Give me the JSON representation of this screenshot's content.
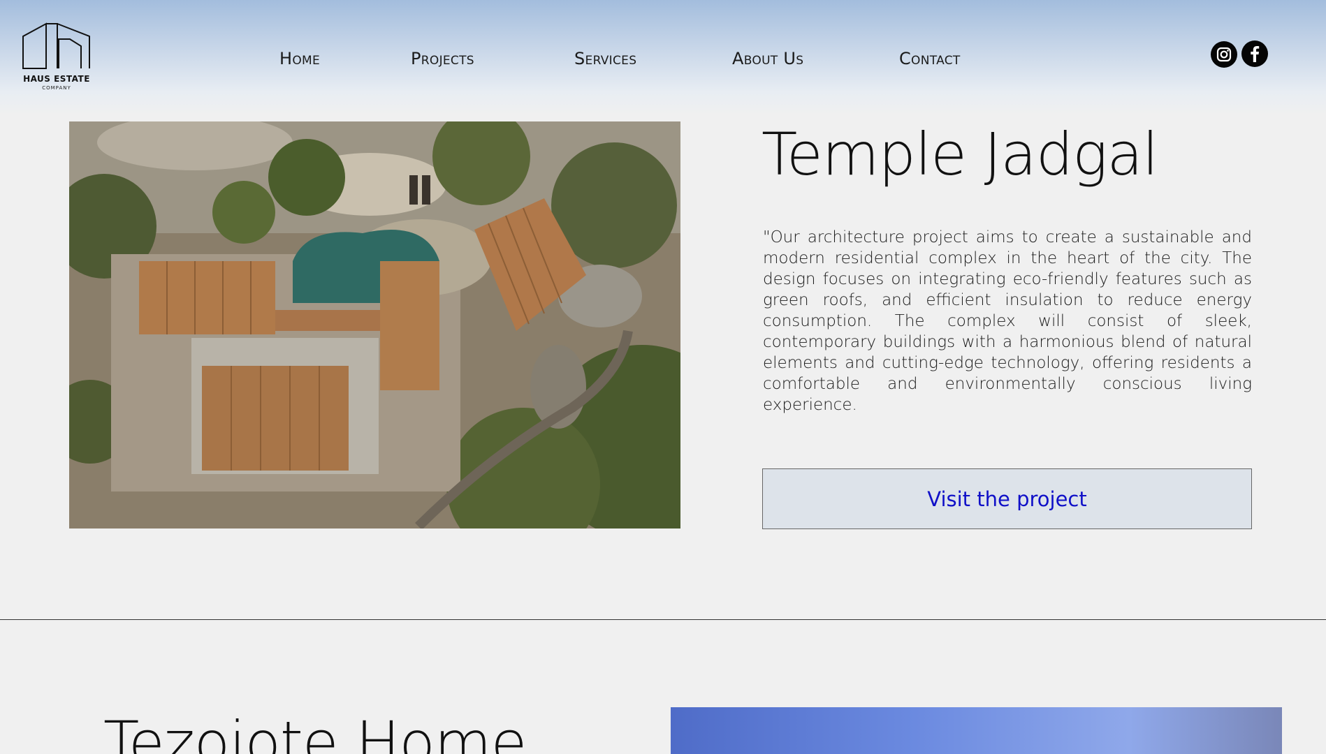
{
  "brand": {
    "name": "HAUS ESTATE",
    "sub": "COMPANY"
  },
  "nav": {
    "items": [
      {
        "label": "Home"
      },
      {
        "label": "Projects"
      },
      {
        "label": "Services"
      },
      {
        "label": "About Us"
      },
      {
        "label": "Contact"
      }
    ]
  },
  "social": {
    "instagram_icon": "instagram-icon",
    "facebook_icon": "facebook-icon"
  },
  "project1": {
    "title": "Temple Jadgal",
    "description": "\"Our architecture project aims to create a sustainable and modern residential complex in the heart of the city. The design focuses on integrating eco-friendly features such as green roofs, and efficient insulation to reduce energy consumption. The complex will consist of sleek, contemporary buildings with a harmonious blend of natural elements and cutting-edge technology, offering residents a comfortable and environmentally conscious living experience.",
    "button_label": "Visit the project"
  },
  "project2": {
    "title": "Tezoiote Home"
  },
  "colors": {
    "link_blue": "#1010c8",
    "button_bg": "#dde3ea",
    "header_top": "#a3bddd",
    "page_bg": "#f0f0f0"
  }
}
